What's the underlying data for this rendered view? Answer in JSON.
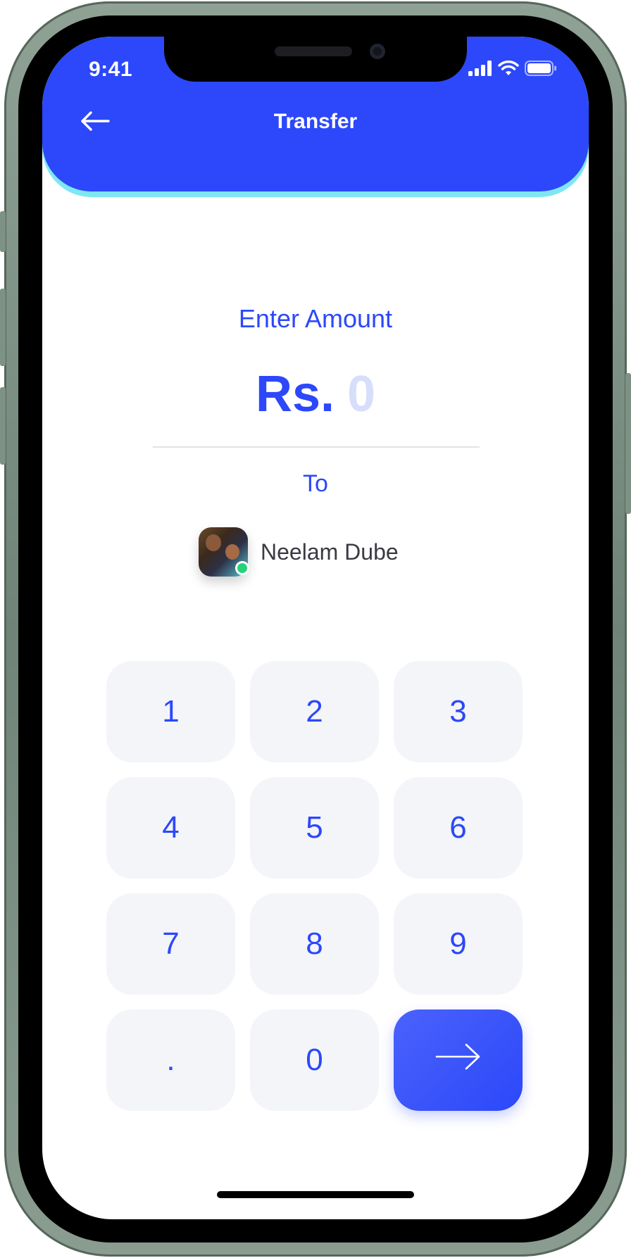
{
  "status_bar": {
    "time": "9:41"
  },
  "header": {
    "title": "Transfer",
    "back_icon": "arrow-left-icon"
  },
  "amount": {
    "label": "Enter Amount",
    "currency": "Rs.",
    "value": "0"
  },
  "recipient": {
    "to_label": "To",
    "name": "Neelam Dube",
    "online": true
  },
  "keypad": {
    "keys": [
      "1",
      "2",
      "3",
      "4",
      "5",
      "6",
      "7",
      "8",
      "9",
      ".",
      "0"
    ],
    "submit_icon": "arrow-right-icon"
  },
  "colors": {
    "accent": "#2c48fa",
    "header_glow": "#7ee7f2",
    "key_bg": "#f4f5f9",
    "amount_placeholder": "#d7defc",
    "online": "#27d17a"
  }
}
